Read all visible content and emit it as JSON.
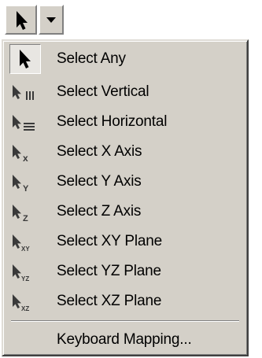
{
  "toolbar": {
    "main_icon": "select-arrow-icon",
    "dropdown_icon": "dropdown-triangle-icon"
  },
  "menu": {
    "items": [
      {
        "label": "Select Any",
        "icon": "select-any-icon",
        "checked": true
      },
      {
        "label": "Select Vertical",
        "icon": "select-vertical-icon"
      },
      {
        "label": "Select Horizontal",
        "icon": "select-horizontal-icon"
      },
      {
        "label": "Select X Axis",
        "icon": "select-x-axis-icon"
      },
      {
        "label": "Select Y Axis",
        "icon": "select-y-axis-icon"
      },
      {
        "label": "Select Z Axis",
        "icon": "select-z-axis-icon"
      },
      {
        "label": "Select XY Plane",
        "icon": "select-xy-plane-icon"
      },
      {
        "label": "Select YZ Plane",
        "icon": "select-yz-plane-icon"
      },
      {
        "label": "Select XZ Plane",
        "icon": "select-xz-plane-icon"
      }
    ],
    "footer_item": {
      "label": "Keyboard Mapping..."
    }
  }
}
